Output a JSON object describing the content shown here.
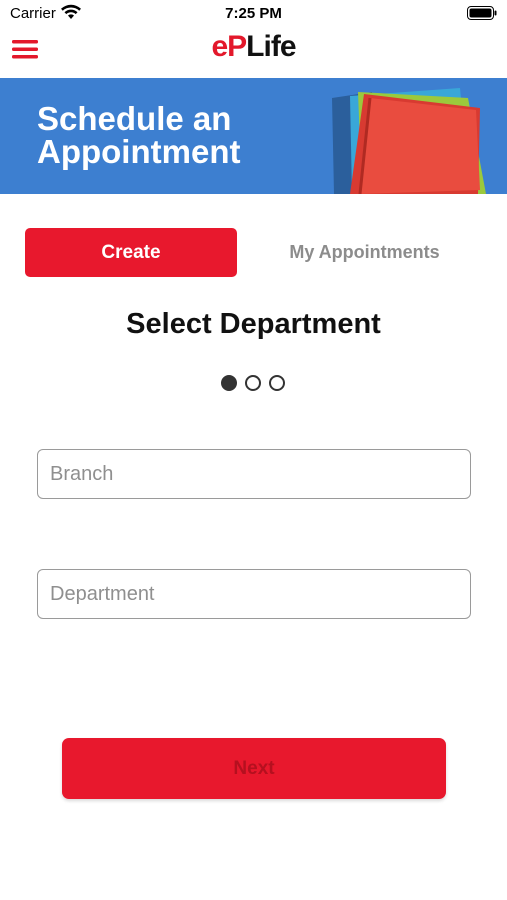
{
  "status_bar": {
    "carrier": "Carrier",
    "time": "7:25 PM"
  },
  "header": {
    "logo_part1": "e",
    "logo_part2": "P",
    "logo_part3": "Life",
    "menu_icon": "hamburger-menu-icon"
  },
  "banner": {
    "title_line1": "Schedule an",
    "title_line2": "Appointment",
    "background_color": "#3d7fd0"
  },
  "tabs": {
    "create_label": "Create",
    "my_appointments_label": "My Appointments",
    "active": "Create"
  },
  "main": {
    "title": "Select Department",
    "steps_total": 3,
    "current_step": 1
  },
  "form": {
    "branch_placeholder": "Branch",
    "department_placeholder": "Department"
  },
  "next_label": "Next",
  "colors": {
    "accent": "#e8182d",
    "banner": "#3d7fd0",
    "inactive_tab_text": "#8c8c8c"
  }
}
